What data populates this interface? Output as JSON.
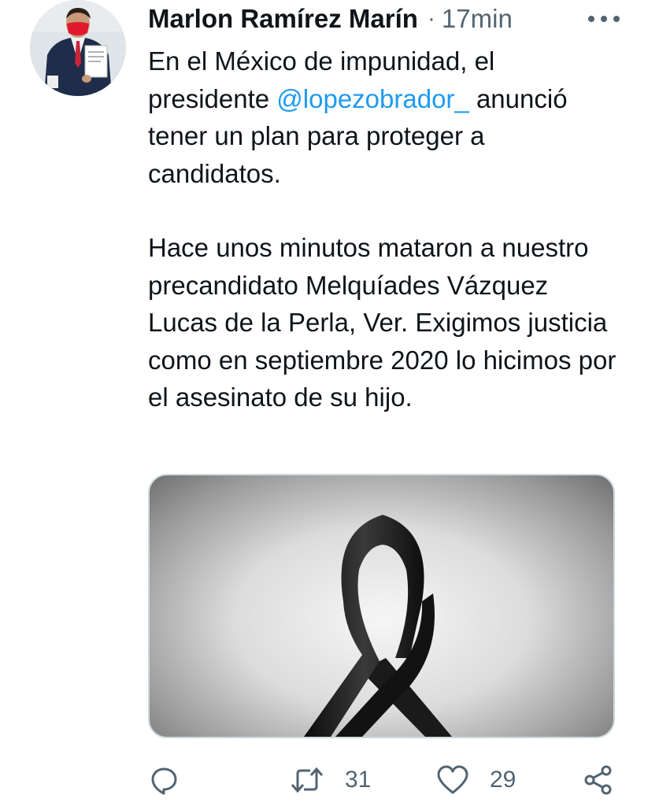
{
  "tweet": {
    "author_name": "Marlon Ramírez Marín",
    "separator": "·",
    "timestamp": "17min",
    "text_part1": "En el México de impunidad, el presidente ",
    "mention": "@lopezobrador_",
    "text_part2": " anunció tener un plan para proteger a candidatos.",
    "paragraph2": "Hace unos minutos mataron a nuestro precandidato Melquíades Vázquez Lucas de la Perla, Ver. Exigimos justicia como en septiembre 2020 lo hicimos por el asesinato de su hijo.",
    "media_icon": "black-mourning-ribbon"
  },
  "actions": {
    "reply_icon": "reply-icon",
    "retweet_icon": "retweet-icon",
    "retweet_count": "31",
    "like_icon": "heart-icon",
    "like_count": "29",
    "share_icon": "share-icon"
  },
  "colors": {
    "text": "#0f1419",
    "secondary": "#536471",
    "link": "#1d9bf0"
  }
}
